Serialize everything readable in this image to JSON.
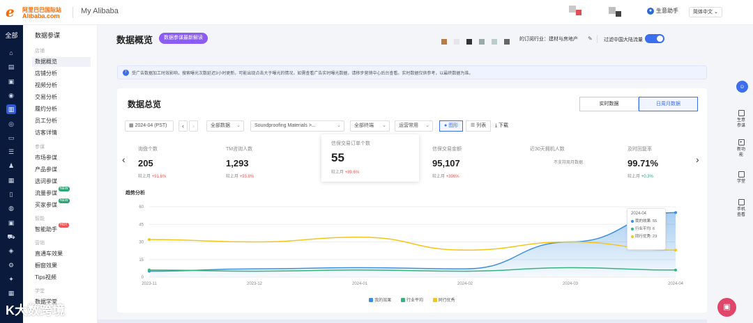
{
  "header": {
    "logo_mark": "ℯ",
    "logo_cn": "阿里巴巴国际站",
    "logo_en": "Alibaba.com",
    "title": "My Alibaba",
    "helper": "生意助手",
    "lang": "简体中文"
  },
  "rail": {
    "all_label": "全部",
    "icons": [
      {
        "name": "home-icon",
        "glyph": "⌂"
      },
      {
        "name": "store-icon",
        "glyph": "▤"
      },
      {
        "name": "product-icon",
        "glyph": "▣"
      },
      {
        "name": "marketing-icon",
        "glyph": "◉"
      },
      {
        "name": "data-icon",
        "glyph": "▥"
      },
      {
        "name": "broadcast-icon",
        "glyph": "◎"
      },
      {
        "name": "message-icon",
        "glyph": "▭"
      },
      {
        "name": "list-icon",
        "glyph": "☰"
      },
      {
        "name": "user-icon",
        "glyph": "♟"
      },
      {
        "name": "order-icon",
        "glyph": "▦"
      },
      {
        "name": "file-icon",
        "glyph": "▯"
      },
      {
        "name": "globe-icon",
        "glyph": "◍"
      },
      {
        "name": "wallet-icon",
        "glyph": "▣"
      },
      {
        "name": "truck-icon",
        "glyph": "⛟"
      },
      {
        "name": "shield-icon",
        "glyph": "◈"
      },
      {
        "name": "gear-icon",
        "glyph": "⚙"
      },
      {
        "name": "star-icon",
        "glyph": "✦"
      },
      {
        "name": "box-icon",
        "glyph": "▦"
      }
    ]
  },
  "subnav": {
    "title": "数据参谋",
    "groups": [
      "店铺",
      "参谋",
      "智能",
      "营销",
      "学堂"
    ],
    "items": [
      {
        "label": "数据概览"
      },
      {
        "label": "店铺分析"
      },
      {
        "label": "视频分析"
      },
      {
        "label": "交易分析"
      },
      {
        "label": "履约分析"
      },
      {
        "label": "员工分析"
      },
      {
        "label": "访客详情"
      },
      {
        "label": "市场参谋"
      },
      {
        "label": "产品参谋"
      },
      {
        "label": "选词参谋"
      },
      {
        "label": "流量参谋",
        "badge": "NEW"
      },
      {
        "label": "买家参谋",
        "badge": "NEW"
      },
      {
        "label": "智能助手",
        "badge": "HOT"
      },
      {
        "label": "直通车效果"
      },
      {
        "label": "橱窗效果"
      },
      {
        "label": "Tips视频"
      },
      {
        "label": "数据学堂"
      }
    ]
  },
  "watermark": "K大数跨境",
  "page": {
    "title": "数据概览",
    "pill": "数据参谋最新解读",
    "subscribe": "的订阅行业：建材与房地产",
    "filter_label": "过滤中国大陆流量",
    "notice": "受广告数据加工时效影响，搜索曝光次数延迟3小时更新，可能出现点击大于曝光的情况，如需查看广告实时曝光数据，请移步营销中心后台查看。实时数据仅供参考，以最终数据为准。"
  },
  "overview": {
    "title": "数据总览",
    "tab_realtime": "实时数据",
    "tab_weekly": "日周月数据",
    "date": "2024-04 (PST)",
    "terminal": "全部数据",
    "category": "Soundproofing Materials >...",
    "channel": "全部终端",
    "compare": "运营常用",
    "view_chart": "图形",
    "view_list": "列表",
    "download": "下载"
  },
  "kpis": [
    {
      "label": "询盘个数",
      "value": "205",
      "cmp_label": "较上月",
      "cmp": "+91.6%",
      "dir": "up"
    },
    {
      "label": "TM咨询人数",
      "value": "1,293",
      "cmp_label": "较上月",
      "cmp": "+93.8%",
      "dir": "up"
    },
    {
      "label": "信保交易订单个数",
      "value": "55",
      "cmp_label": "较上月",
      "cmp": "+89.6%",
      "dir": "up"
    },
    {
      "label": "信保交易金额",
      "value": "95,107",
      "cmp_label": "较上月",
      "cmp": "+396%",
      "dir": "up"
    },
    {
      "label": "近30天拥机人数",
      "value": "",
      "cmp_label": "",
      "cmp": "",
      "note": "不支持周月数据"
    },
    {
      "label": "及时回复率",
      "value": "99.71%",
      "cmp_label": "较上月",
      "cmp": "+0.3%",
      "dir": "green"
    }
  ],
  "chart_title": "趋势分析",
  "tooltip": {
    "title": "2024-04",
    "rows": [
      "我的效果: 55",
      "行业平均: 6",
      "同行优秀: 23"
    ]
  },
  "colors": {
    "mine": "#3b8fe0",
    "avg": "#36b37e",
    "top": "#f5c518",
    "accent": "#3c6ff0",
    "rail": "#0a1a3d"
  },
  "chart_data": {
    "type": "line",
    "x": [
      "2023-11",
      "2023-12",
      "2024-01",
      "2024-02",
      "2024-03",
      "2024-04"
    ],
    "ylim": [
      0,
      60
    ],
    "yticks": [
      0,
      15,
      30,
      45,
      60
    ],
    "series": [
      {
        "name": "我的效果",
        "values": [
          5,
          7,
          8,
          7,
          30,
          55
        ],
        "color": "#3b8fe0",
        "area": true
      },
      {
        "name": "行业平均",
        "values": [
          6,
          5,
          6,
          5,
          8,
          6
        ],
        "color": "#36b37e"
      },
      {
        "name": "同行优秀",
        "values": [
          32,
          30,
          34,
          23,
          30,
          23
        ],
        "color": "#f5c518"
      }
    ],
    "legend": "bottom"
  },
  "right_sidebar": [
    {
      "icon": "app-icon",
      "label": "生意参谋"
    },
    {
      "icon": "new-feature-icon",
      "label": "新功能"
    },
    {
      "icon": "video-icon",
      "label": "学堂"
    },
    {
      "icon": "mobile-icon",
      "label": "手机查看"
    }
  ]
}
